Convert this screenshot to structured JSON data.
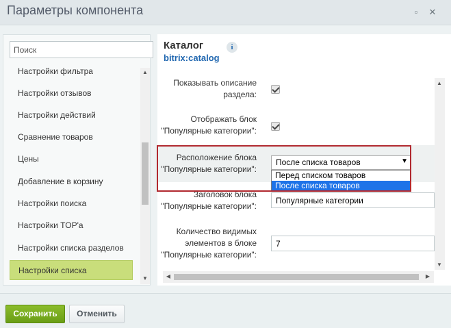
{
  "window": {
    "title": "Параметры компонента",
    "buttons": {
      "maximize_icon": "square-icon",
      "close_icon": "close-icon",
      "maximize_glyph": "▫",
      "close_glyph": "✕"
    }
  },
  "sidebar": {
    "search_placeholder": "Поиск",
    "items": [
      {
        "label": "Настройки фильтра"
      },
      {
        "label": "Настройки отзывов"
      },
      {
        "label": "Настройки действий"
      },
      {
        "label": "Сравнение товаров"
      },
      {
        "label": "Цены"
      },
      {
        "label": "Добавление в корзину"
      },
      {
        "label": "Настройки поиска"
      },
      {
        "label": "Настройки TOP'а"
      },
      {
        "label": "Настройки списка разделов"
      },
      {
        "label": "Настройки списка",
        "active": true
      }
    ]
  },
  "component": {
    "title": "Каталог",
    "code": "bitrix:catalog",
    "info_glyph": "i"
  },
  "params": {
    "show_description": {
      "label": "Показывать описание раздела:",
      "checked": true
    },
    "show_popular": {
      "label": "Отображать блок \"Популярные категории\":",
      "checked": true
    },
    "popular_position": {
      "label": "Расположение блока \"Популярные категории\":",
      "value": "После списка товаров",
      "caret": "▼",
      "options": [
        "Перед списком товаров",
        "После списка товаров"
      ],
      "selected_index": 1
    },
    "popular_title": {
      "label": "Заголовок блока \"Популярные категории\":",
      "value": "Популярные категории"
    },
    "popular_count": {
      "label": "Количество видимых элементов в блоке \"Популярные категории\":",
      "value": "7"
    }
  },
  "footer": {
    "save_label": "Сохранить",
    "cancel_label": "Отменить"
  },
  "colors": {
    "accent": "#2067b0",
    "save_green": "#6a9e16",
    "active_item": "#c9de7b",
    "highlight_frame": "#b1292f",
    "selected_option": "#1e73e8"
  }
}
